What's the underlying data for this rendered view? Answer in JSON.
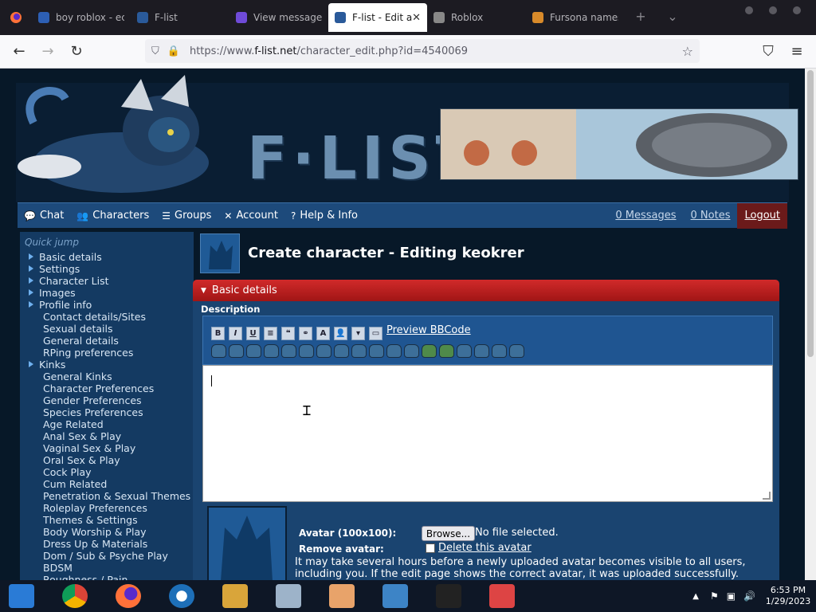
{
  "browser": {
    "tabs": [
      {
        "label": "boy roblox - ec",
        "fav": "#2d5fb4"
      },
      {
        "label": "F-list",
        "fav": "#2a5a9a"
      },
      {
        "label": "View message -",
        "fav": "#6f4bd8"
      },
      {
        "label": "F-list - Edit a",
        "fav": "#2a5a9a",
        "active": true
      },
      {
        "label": "Roblox",
        "fav": "#888888"
      },
      {
        "label": "Fursona names",
        "fav": "#d88a2a"
      }
    ],
    "url_scheme": "https://www.",
    "url_host": "f-list.net",
    "url_path": "/character_edit.php?id=4540069"
  },
  "site": {
    "logo_text": "F·LIST",
    "menu": [
      {
        "label": "Chat",
        "icon": "chat-icon",
        "glyph": "💬"
      },
      {
        "label": "Characters",
        "icon": "characters-icon",
        "glyph": "👥"
      },
      {
        "label": "Groups",
        "icon": "groups-icon",
        "glyph": "☰"
      },
      {
        "label": "Account",
        "icon": "account-icon",
        "glyph": "✕"
      },
      {
        "label": "Help & Info",
        "icon": "help-icon",
        "glyph": "?"
      }
    ],
    "messages": "0 Messages",
    "notes": "0 Notes",
    "logout": "Logout"
  },
  "sidebar": {
    "quick_jump": "Quick jump",
    "items": [
      {
        "label": "Basic details",
        "level": "top"
      },
      {
        "label": "Settings",
        "level": "top"
      },
      {
        "label": "Character List",
        "level": "top"
      },
      {
        "label": "Images",
        "level": "top"
      },
      {
        "label": "Profile info",
        "level": "top"
      },
      {
        "label": "Contact details/Sites",
        "level": "sub"
      },
      {
        "label": "Sexual details",
        "level": "sub"
      },
      {
        "label": "General details",
        "level": "sub"
      },
      {
        "label": "RPing preferences",
        "level": "sub"
      },
      {
        "label": "Kinks",
        "level": "top"
      },
      {
        "label": "General Kinks",
        "level": "sub"
      },
      {
        "label": "Character Preferences",
        "level": "sub"
      },
      {
        "label": "Gender Preferences",
        "level": "sub"
      },
      {
        "label": "Species Preferences",
        "level": "sub"
      },
      {
        "label": "Age Related",
        "level": "sub"
      },
      {
        "label": "Anal Sex & Play",
        "level": "sub"
      },
      {
        "label": "Vaginal Sex & Play",
        "level": "sub"
      },
      {
        "label": "Oral Sex & Play",
        "level": "sub"
      },
      {
        "label": "Cock Play",
        "level": "sub"
      },
      {
        "label": "Cum Related",
        "level": "sub"
      },
      {
        "label": "Penetration & Sexual Themes",
        "level": "sub"
      },
      {
        "label": "Roleplay Preferences",
        "level": "sub"
      },
      {
        "label": "Themes & Settings",
        "level": "sub"
      },
      {
        "label": "Body Worship & Play",
        "level": "sub"
      },
      {
        "label": "Dress Up & Materials",
        "level": "sub"
      },
      {
        "label": "Dom / Sub & Psyche Play",
        "level": "sub"
      },
      {
        "label": "BDSM",
        "level": "sub"
      },
      {
        "label": "Roughness / Pain",
        "level": "sub"
      }
    ]
  },
  "editor": {
    "page_title": "Create character - Editing keokrer",
    "section": "Basic details",
    "description_label": "Description",
    "format_buttons": [
      "B",
      "I",
      "U",
      "≡",
      "❝",
      "⚭",
      "A",
      "👤",
      "▾",
      "▭"
    ],
    "preview": "Preview BBCode",
    "avatar_label": "Avatar (100x100):",
    "browse": "Browse...",
    "no_file": "No file selected.",
    "remove_label": "Remove avatar:",
    "delete_link": "Delete this avatar",
    "note": "It may take several hours before a newly uploaded avatar becomes visible to all users, including you. If the edit page shows the correct avatar, it was uploaded successfully."
  },
  "taskbar": {
    "apps": [
      "chrome-logo-icon",
      "chrome-icon",
      "firefox-icon",
      "obama-icon",
      "file-explorer-icon",
      "task-manager-icon",
      "user-icon",
      "photo-icon",
      "cmd-icon",
      "java-icon"
    ],
    "time": "6:53 PM",
    "date": "1/29/2023"
  }
}
